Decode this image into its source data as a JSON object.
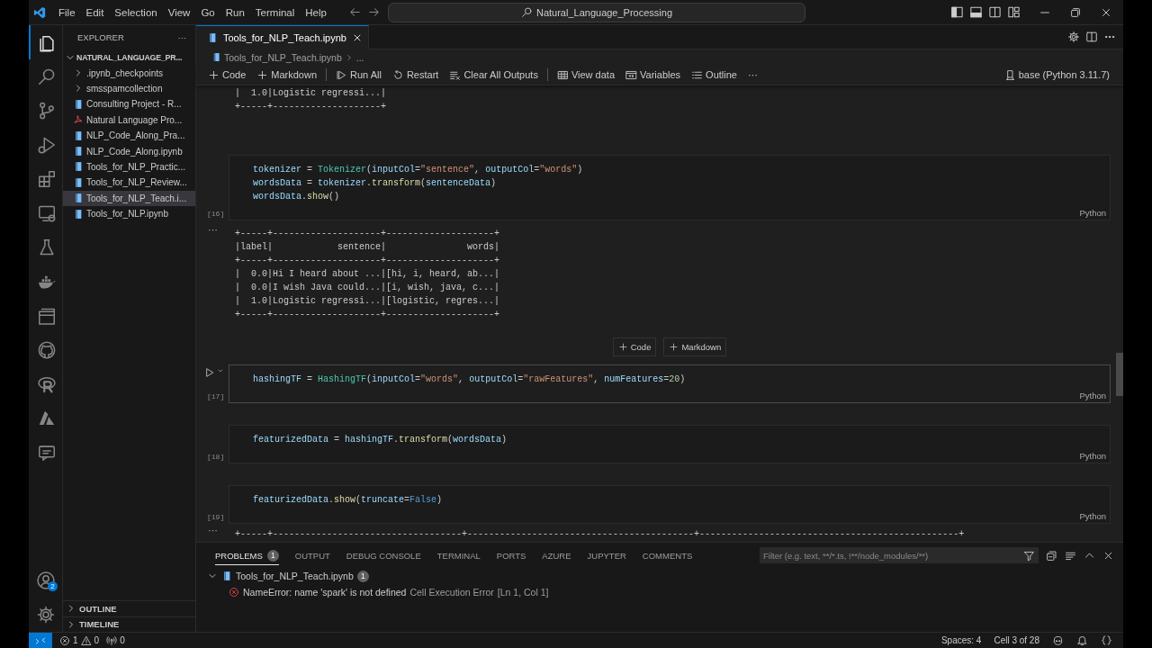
{
  "title_bar": {
    "menu": [
      "File",
      "Edit",
      "Selection",
      "View",
      "Go",
      "Run",
      "Terminal",
      "Help"
    ],
    "command_center": "Natural_Language_Processing"
  },
  "activity_bar": {
    "items": [
      {
        "kind": "files",
        "selected": true
      },
      {
        "kind": "search",
        "selected": false
      },
      {
        "kind": "source-control",
        "selected": false
      },
      {
        "kind": "run-debug",
        "selected": false
      },
      {
        "kind": "extensions",
        "selected": false
      },
      {
        "kind": "remote",
        "selected": false
      },
      {
        "kind": "testing",
        "selected": false
      },
      {
        "kind": "docker",
        "selected": false
      },
      {
        "kind": "stack",
        "selected": false
      },
      {
        "kind": "github",
        "selected": false
      },
      {
        "kind": "r",
        "selected": false
      },
      {
        "kind": "azure",
        "selected": false
      },
      {
        "kind": "chat",
        "selected": false
      }
    ],
    "accounts_badge": "2"
  },
  "sidebar": {
    "title": "EXPLORER",
    "more": "···",
    "folder": {
      "label": "NATURAL_LANGUAGE_PR...",
      "expanded": true
    },
    "items": [
      {
        "label": ".ipynb_checkpoints",
        "kind": "folder",
        "selected": false
      },
      {
        "label": "smsspamcollection",
        "kind": "folder",
        "selected": false
      },
      {
        "label": "Consulting Project - R...",
        "kind": "notebook",
        "selected": false
      },
      {
        "label": "Natural Language Pro...",
        "kind": "pdf",
        "selected": false
      },
      {
        "label": "NLP_Code_Along_Pra...",
        "kind": "notebook",
        "selected": false
      },
      {
        "label": "NLP_Code_Along.ipynb",
        "kind": "notebook",
        "selected": false
      },
      {
        "label": "Tools_for_NLP_Practic...",
        "kind": "notebook",
        "selected": false
      },
      {
        "label": "Tools_for_NLP_Review...",
        "kind": "notebook",
        "selected": false
      },
      {
        "label": "Tools_for_NLP_Teach.i...",
        "kind": "notebook",
        "selected": true
      },
      {
        "label": "Tools_for_NLP.ipynb",
        "kind": "notebook",
        "selected": false
      }
    ],
    "sections": [
      {
        "label": "OUTLINE",
        "expanded": false
      },
      {
        "label": "TIMELINE",
        "expanded": false
      }
    ]
  },
  "tabs": [
    {
      "label": "Tools_for_NLP_Teach.ipynb",
      "selected": true
    }
  ],
  "breadcrumb": [
    "Tools_for_NLP_Teach.ipynb",
    "..."
  ],
  "toolbar": {
    "items": [
      {
        "kind": "add",
        "label": "Code"
      },
      {
        "kind": "add",
        "label": "Markdown"
      },
      {
        "kind": "separator"
      },
      {
        "kind": "run-all",
        "label": "Run All"
      },
      {
        "kind": "restart",
        "label": "Restart"
      },
      {
        "kind": "clear",
        "label": "Clear All Outputs"
      },
      {
        "kind": "separator"
      },
      {
        "kind": "view-data",
        "label": "View data"
      },
      {
        "kind": "variables",
        "label": "Variables"
      },
      {
        "kind": "outline",
        "label": "Outline"
      },
      {
        "kind": "more",
        "label": "···"
      }
    ],
    "kernel": "base (Python 3.11.7)"
  },
  "cells": [
    {
      "kind": "output",
      "lines": [
        "|  1.0|Logistic regressi...|",
        "+-----+--------------------+"
      ]
    },
    {
      "kind": "code",
      "count": "[16]",
      "language": "Python",
      "focused": false,
      "lines": [
        [
          {
            "kind": "var",
            "text": "tokenizer"
          },
          {
            "kind": "op",
            "text": " = "
          },
          {
            "kind": "cls",
            "text": "Tokenizer"
          },
          {
            "kind": "op",
            "text": "("
          },
          {
            "kind": "param",
            "text": "inputCol"
          },
          {
            "kind": "op",
            "text": "="
          },
          {
            "kind": "str",
            "text": "\"sentence\""
          },
          {
            "kind": "op",
            "text": ", "
          },
          {
            "kind": "param",
            "text": "outputCol"
          },
          {
            "kind": "op",
            "text": "="
          },
          {
            "kind": "str",
            "text": "\"words\""
          },
          {
            "kind": "op",
            "text": ")"
          }
        ],
        [
          {
            "kind": "var",
            "text": "wordsData"
          },
          {
            "kind": "op",
            "text": " = "
          },
          {
            "kind": "var",
            "text": "tokenizer"
          },
          {
            "kind": "op",
            "text": "."
          },
          {
            "kind": "fn",
            "text": "transform"
          },
          {
            "kind": "op",
            "text": "("
          },
          {
            "kind": "var",
            "text": "sentenceData"
          },
          {
            "kind": "op",
            "text": ")"
          }
        ],
        [
          {
            "kind": "var",
            "text": "wordsData"
          },
          {
            "kind": "op",
            "text": "."
          },
          {
            "kind": "fn",
            "text": "show"
          },
          {
            "kind": "op",
            "text": "()"
          }
        ]
      ]
    },
    {
      "kind": "output",
      "marker": "···",
      "lines": [
        "+-----+--------------------+--------------------+",
        "|label|            sentence|               words|",
        "+-----+--------------------+--------------------+",
        "|  0.0|Hi I heard about ...|[hi, i, heard, ab...|",
        "|  0.0|I wish Java could...|[i, wish, java, c...|",
        "|  1.0|Logistic regressi...|[logistic, regres...|",
        "+-----+--------------------+--------------------+"
      ]
    },
    {
      "kind": "insert",
      "buttons": [
        "Code",
        "Markdown"
      ]
    },
    {
      "kind": "code",
      "count": "[17]",
      "language": "Python",
      "focused": true,
      "lines": [
        [
          {
            "kind": "var",
            "text": "hashingTF"
          },
          {
            "kind": "op",
            "text": " = "
          },
          {
            "kind": "cls",
            "text": "HashingTF"
          },
          {
            "kind": "op",
            "text": "("
          },
          {
            "kind": "param",
            "text": "inputCol"
          },
          {
            "kind": "op",
            "text": "="
          },
          {
            "kind": "str",
            "text": "\"words\""
          },
          {
            "kind": "op",
            "text": ", "
          },
          {
            "kind": "param",
            "text": "outputCol"
          },
          {
            "kind": "op",
            "text": "="
          },
          {
            "kind": "str",
            "text": "\"rawFeatures\""
          },
          {
            "kind": "op",
            "text": ", "
          },
          {
            "kind": "param",
            "text": "numFeatures"
          },
          {
            "kind": "op",
            "text": "="
          },
          {
            "kind": "num",
            "text": "20"
          },
          {
            "kind": "op",
            "text": ")"
          }
        ]
      ]
    },
    {
      "kind": "code",
      "count": "[18]",
      "language": "Python",
      "focused": false,
      "lines": [
        [
          {
            "kind": "var",
            "text": "featurizedData"
          },
          {
            "kind": "op",
            "text": " = "
          },
          {
            "kind": "var",
            "text": "hashingTF"
          },
          {
            "kind": "op",
            "text": "."
          },
          {
            "kind": "fn",
            "text": "transform"
          },
          {
            "kind": "op",
            "text": "("
          },
          {
            "kind": "var",
            "text": "wordsData"
          },
          {
            "kind": "op",
            "text": ")"
          }
        ]
      ]
    },
    {
      "kind": "code",
      "count": "[19]",
      "language": "Python",
      "focused": false,
      "lines": [
        [
          {
            "kind": "var",
            "text": "featurizedData"
          },
          {
            "kind": "op",
            "text": "."
          },
          {
            "kind": "fn",
            "text": "show"
          },
          {
            "kind": "op",
            "text": "("
          },
          {
            "kind": "param",
            "text": "truncate"
          },
          {
            "kind": "op",
            "text": "="
          },
          {
            "kind": "kw",
            "text": "False"
          },
          {
            "kind": "op",
            "text": ")"
          }
        ]
      ]
    },
    {
      "kind": "output",
      "marker": "···",
      "lines": [
        "+-----+-----------------------------------+------------------------------------------+------------------------------------------------+"
      ]
    }
  ],
  "panel": {
    "tabs": [
      {
        "label": "PROBLEMS",
        "badge": "1",
        "selected": true
      },
      {
        "label": "OUTPUT",
        "selected": false
      },
      {
        "label": "DEBUG CONSOLE",
        "selected": false
      },
      {
        "label": "TERMINAL",
        "selected": false
      },
      {
        "label": "PORTS",
        "selected": false
      },
      {
        "label": "AZURE",
        "selected": false
      },
      {
        "label": "JUPYTER",
        "selected": false
      },
      {
        "label": "COMMENTS",
        "selected": false
      }
    ],
    "filter": {
      "placeholder": "Filter (e.g. text, **/*.ts, !**/node_modules/**)"
    },
    "problems": [
      {
        "file": "Tools_for_NLP_Teach.ipynb",
        "count": "1",
        "expanded": true,
        "items": [
          {
            "message": "NameError: name 'spark' is not defined",
            "source": "Cell Execution Error",
            "location": "[Ln 1, Col 1]"
          }
        ]
      }
    ]
  },
  "status_bar": {
    "errors": "1",
    "warnings": "0",
    "ports": "0",
    "spaces": "Spaces: 4",
    "cell": "Cell 3 of 28"
  }
}
